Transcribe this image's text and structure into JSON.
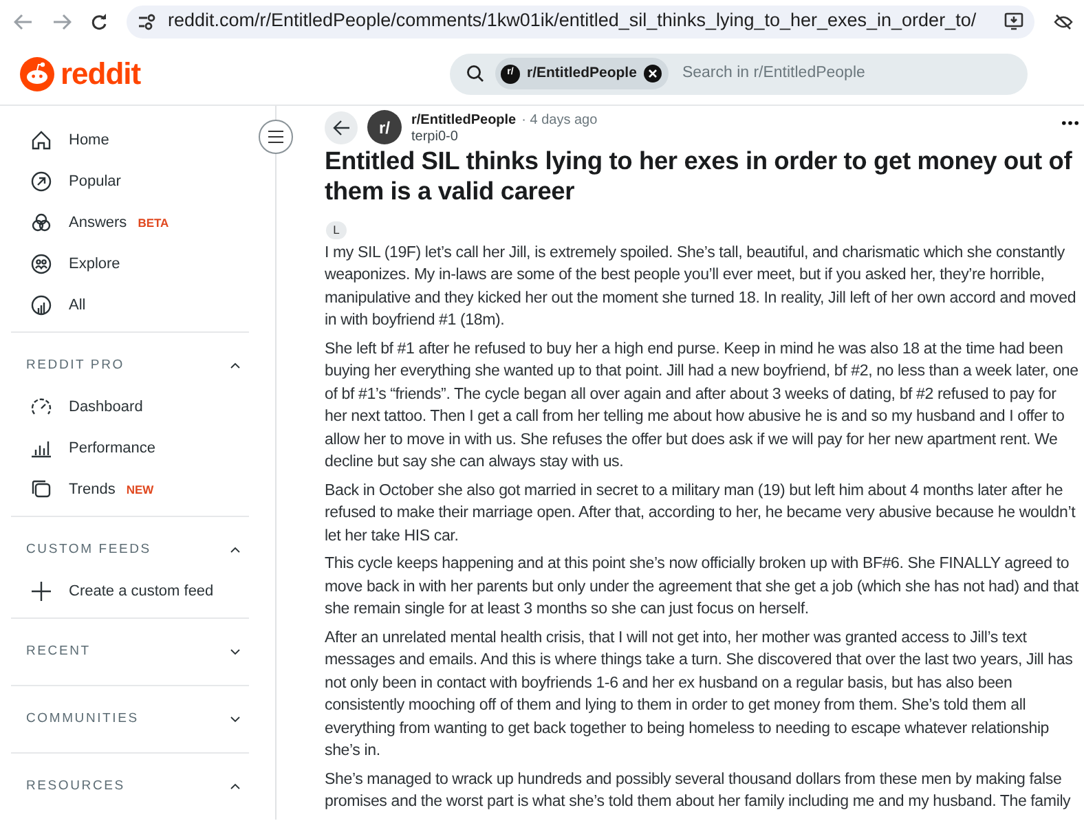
{
  "browser": {
    "url": "reddit.com/r/EntitledPeople/comments/1kw01ik/entitled_sil_thinks_lying_to_her_exes_in_order_to/"
  },
  "header": {
    "logo_text": "reddit",
    "search": {
      "chip": "r/EntitledPeople",
      "chip_icon": "r/",
      "placeholder": "Search in r/EntitledPeople"
    }
  },
  "sidebar": {
    "nav": [
      {
        "label": "Home"
      },
      {
        "label": "Popular"
      },
      {
        "label": "Answers",
        "badge": "BETA"
      },
      {
        "label": "Explore"
      },
      {
        "label": "All"
      }
    ],
    "sections": [
      {
        "title": "REDDIT PRO",
        "expanded": true,
        "items": [
          {
            "label": "Dashboard"
          },
          {
            "label": "Performance"
          },
          {
            "label": "Trends",
            "badge": "NEW"
          }
        ]
      },
      {
        "title": "CUSTOM FEEDS",
        "expanded": true,
        "items": [
          {
            "label": "Create a custom feed"
          }
        ]
      },
      {
        "title": "RECENT",
        "expanded": false
      },
      {
        "title": "COMMUNITIES",
        "expanded": false
      },
      {
        "title": "RESOURCES",
        "expanded": true
      }
    ]
  },
  "post": {
    "avatar": "r/",
    "subreddit": "r/EntitledPeople",
    "separator": "·",
    "time": "4 days ago",
    "author": "terpi0-0",
    "title": "Entitled SIL thinks lying to her exes in order to get money out of them is a valid career",
    "flair": "L",
    "paragraphs": [
      "I my SIL (19F) let’s call her Jill, is extremely spoiled. She’s tall, beautiful, and charismatic which she constantly weaponizes. My in-laws are some of the best people you’ll ever meet, but if you asked her, they’re horrible, manipulative and they kicked her out the moment she turned 18. In reality, Jill left of her own accord and moved in with boyfriend #1 (18m).",
      "She left bf #1 after he refused to buy her a high end purse. Keep in mind he was also 18 at the time had been buying her everything she wanted up to that point. Jill had a new boyfriend, bf #2, no less than a week later, one of bf #1’s “friends”. The cycle began all over again and after about 3 weeks of dating, bf #2 refused to pay for her next tattoo. Then I get a call from her telling me about how abusive he is and so my husband and I offer to allow her to move in with us. She refuses the offer but does ask if we will pay for her new apartment rent. We decline but say she can always stay with us.",
      "Back in October she also got married in secret to a military man (19) but left him about 4 months later after he refused to make their marriage open. After that, according to her, he became very abusive because he wouldn’t let her take HIS car.",
      "This cycle keeps happening and at this point she’s now officially broken up with BF#6. She FINALLY agreed to move back in with her parents but only under the agreement that she get a job (which she has not had) and that she remain single for at least 3 months so she can just focus on herself.",
      "After an unrelated mental health crisis, that I will not get into, her mother was granted access to Jill’s text messages and emails. And this is where things take a turn. She discovered that over the last two years, Jill has not only been in contact with boyfriends 1-6 and her ex husband on a regular basis, but has also been consistently mooching off of them and lying to them in order to get money from them. She’s told them all everything from wanting to get back together to being homeless to needing to escape whatever relationship she’s in.",
      "She’s managed to wrack up hundreds and possibly several thousand dollars from these men by making false promises and the worst part is what she’s told them about her family including me and my husband. The family"
    ]
  }
}
